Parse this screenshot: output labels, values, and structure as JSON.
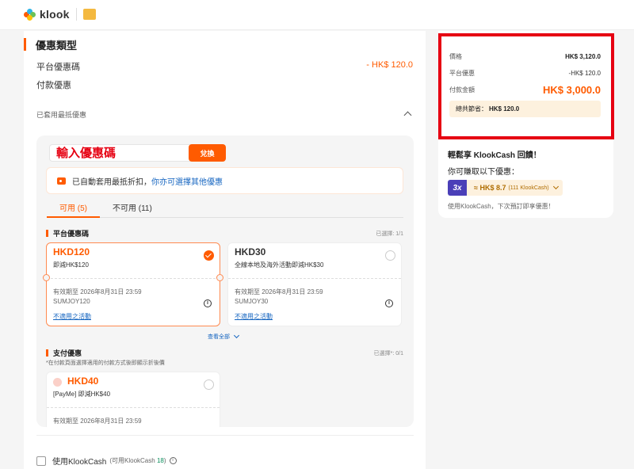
{
  "header": {
    "brand": "klook",
    "colors": {
      "accent": "#ff5b00",
      "highlight": "#e60012",
      "link": "#1565c0"
    }
  },
  "promo": {
    "section_title": "優惠類型",
    "platform_label": "平台優惠碼",
    "platform_value": "- HK$ 120.0",
    "payment_label": "付款優惠",
    "applied_label": "已套用最抵優惠",
    "input_placeholder": "輸入優惠碼",
    "redeem_label": "兌換",
    "auto_text": "已自動套用最抵折扣，",
    "auto_link": "你亦可選擇其他優惠",
    "tabs": [
      {
        "label": "可用 (5)"
      },
      {
        "label": "不可用 (11)"
      }
    ],
    "group1": {
      "title": "平台優惠碼",
      "count": "已選擇: 1/1",
      "cards": [
        {
          "code": "HKD120",
          "desc": "即減HK$120",
          "valid": "有效期至 2026年8月31日 23:59",
          "sub": "SUMJOY120",
          "link": "不適用之活動"
        },
        {
          "code": "HKD30",
          "desc": "全線本地及海外活動即減HK$30",
          "valid": "有效期至 2026年8月31日 23:59",
          "sub": "SUMJOY30",
          "link": "不適用之活動"
        }
      ],
      "view_all": "查看全部"
    },
    "group2": {
      "title": "支付優惠",
      "count": "已選擇*: 0/1",
      "note": "*在付款頁面選擇適用的付款方式後即顯示折後價",
      "card": {
        "code": "HKD40",
        "desc": "[PayMe] 即減HK$40",
        "valid": "有效期至 2026年8月31日 23:59"
      }
    },
    "klookcash": {
      "label": "使用KlookCash",
      "avail_prefix": "(可用KlookCash ",
      "avail_num": "18",
      "avail_suffix": ")"
    }
  },
  "summary": {
    "price_label": "價格",
    "price_value": "HK$ 3,120.0",
    "discount_label": "平台優惠",
    "discount_value": "-HK$ 120.0",
    "pay_label": "付款金額",
    "pay_value": "HK$ 3,000.0",
    "save_label": "總共節省：",
    "save_value": "HK$ 120.0",
    "kc_title": "輕鬆享 KlookCash 回饋！",
    "kc_earn": "你可賺取以下優惠：",
    "kc_multiplier": "3x",
    "kc_amount": "≈ HK$ 8.7",
    "kc_detail": "(111 KlookCash)",
    "kc_foot": "使用KlookCash，下次預訂即享優惠！"
  }
}
